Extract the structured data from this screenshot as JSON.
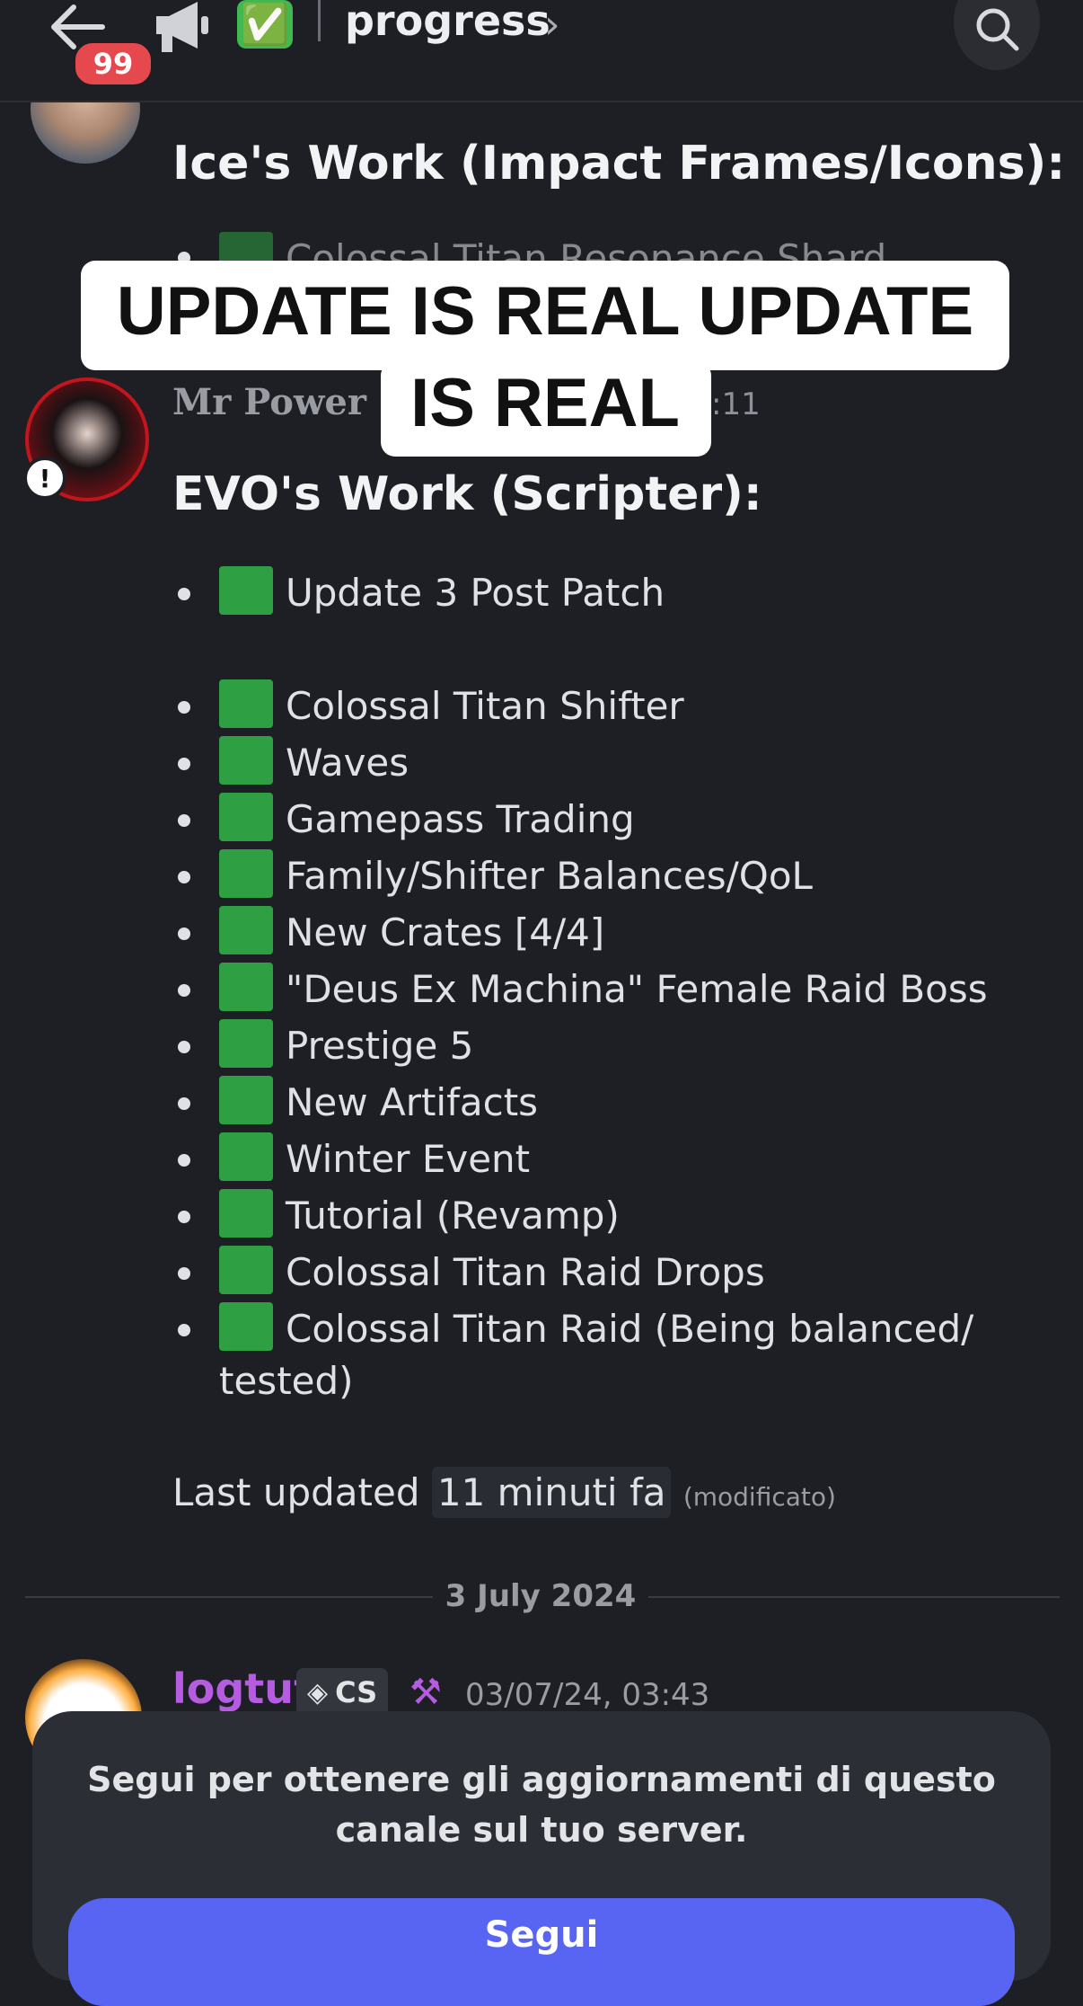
{
  "header": {
    "unread_count": "99",
    "channel_check": "✅",
    "channel_name": "progress",
    "chevron": "›"
  },
  "ice_message": {
    "heading": "Ice's Work (Impact Frames/Icons):",
    "first_item": "Colossal Titan Resonance Shard"
  },
  "overlay": {
    "line": "UPDATE IS REAL UPDATE IS REAL"
  },
  "evo_message": {
    "author": "Mr Power",
    "time_fragment": ":11",
    "heading": "EVO's Work (Scripter):",
    "items": [
      "Update 3 Post Patch",
      "Colossal Titan Shifter",
      "Waves",
      "Gamepass Trading",
      "Family/Shifter Balances/QoL",
      "New Crates [4/4]",
      "\"Deus Ex Machina\" Female Raid Boss",
      "Prestige 5",
      "New Artifacts",
      "Winter Event",
      "Tutorial (Revamp)",
      "Colossal Titan Raid Drops",
      "Colossal Titan Raid (Being balanced/",
      "tested)"
    ],
    "last_updated_label": "Last updated",
    "last_updated_time": "11 minuti fa",
    "edited": "(modificato)"
  },
  "date_divider": "3 July 2024",
  "logtuf_message": {
    "author": "logtuf",
    "tag": "CS",
    "timestamp": "03/07/24, 03:43"
  },
  "follow_sheet": {
    "text": "Segui per ottenere gli aggiornamenti di questo canale sul tuo server.",
    "button": "Segui"
  },
  "colors": {
    "background": "#1e1f24",
    "check_green": "#2ea043",
    "username_purple": "#b55ce0",
    "button_blue": "#5865f2"
  }
}
